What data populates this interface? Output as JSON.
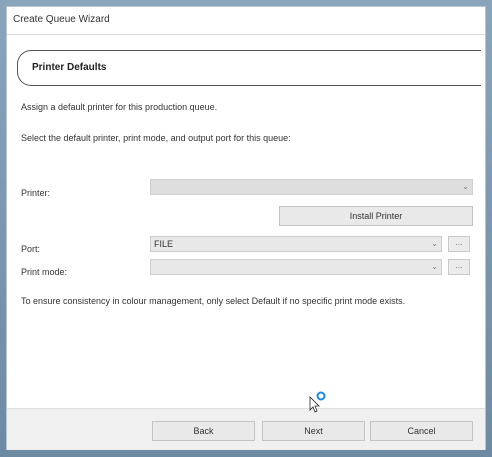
{
  "window": {
    "title": "Create Queue Wizard"
  },
  "header": {
    "title": "Printer Defaults"
  },
  "body": {
    "description": "Assign a default printer for this production queue.",
    "instruction": "Select the default printer, print mode, and output port for this queue:",
    "note": "To ensure consistency in colour management, only select Default if no specific print mode exists."
  },
  "form": {
    "printer_label": "Printer:",
    "printer_value": "",
    "install_printer_label": "Install Printer",
    "port_label": "Port:",
    "port_value": "FILE",
    "print_mode_label": "Print mode:",
    "print_mode_value": "",
    "browse_label": "..."
  },
  "footer": {
    "back_label": "Back",
    "next_label": "Next",
    "cancel_label": "Cancel"
  },
  "icons": {
    "dropdown": "chevron-down-icon",
    "cursor": "cursor-busy-icon"
  },
  "colors": {
    "frame": "#6d8aa3",
    "field_disabled": "#dedede",
    "busy_ring": "#1e88e5"
  }
}
